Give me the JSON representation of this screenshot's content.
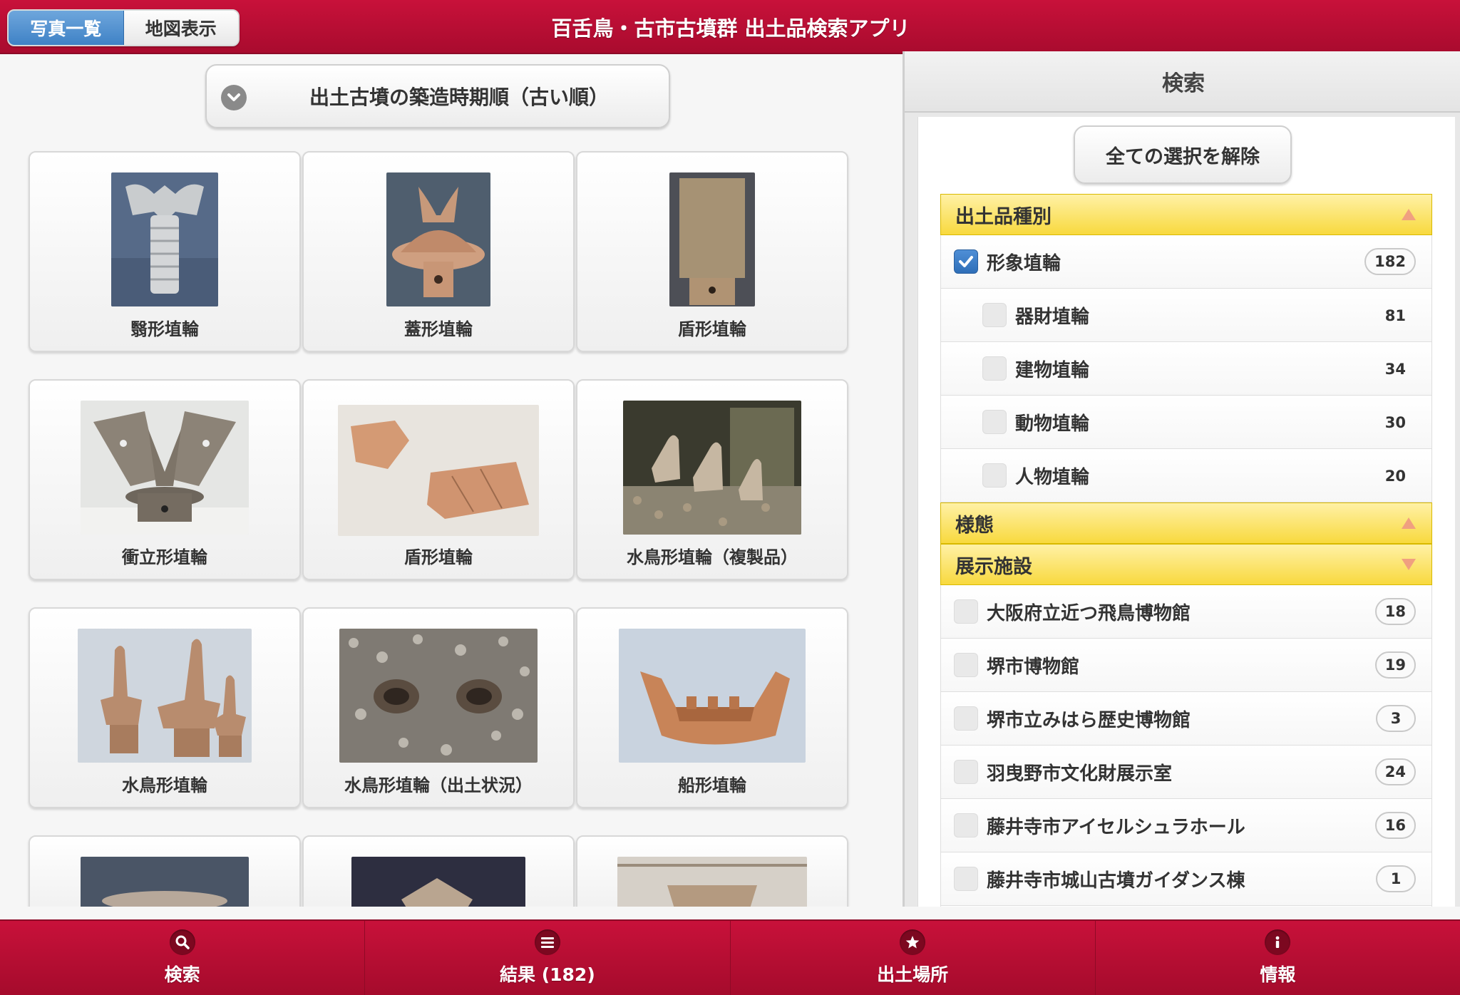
{
  "header": {
    "tabs": [
      {
        "label": "写真一覧",
        "active": true
      },
      {
        "label": "地図表示",
        "active": false
      }
    ],
    "title": "百舌鳥・古市古墳群 出土品検索アプリ"
  },
  "sort": {
    "label": "出土古墳の築造時期順（古い順）",
    "icon": "chevron-down-icon"
  },
  "results": [
    {
      "label": "翳形埴輪",
      "thumb": "ceremonial-fan-haniwa-photo"
    },
    {
      "label": "蓋形埴輪",
      "thumb": "parasol-haniwa-photo"
    },
    {
      "label": "盾形埴輪",
      "thumb": "shield-haniwa-photo"
    },
    {
      "label": "衝立形埴輪",
      "thumb": "screen-haniwa-photo"
    },
    {
      "label": "盾形埴輪",
      "thumb": "shield-fragments-photo"
    },
    {
      "label": "水鳥形埴輪（複製品）",
      "thumb": "waterfowl-replica-photo"
    },
    {
      "label": "水鳥形埴輪",
      "thumb": "waterfowl-haniwa-photo"
    },
    {
      "label": "水鳥形埴輪（出土状況）",
      "thumb": "waterfowl-excavation-photo"
    },
    {
      "label": "船形埴輪",
      "thumb": "boat-haniwa-photo"
    }
  ],
  "search_panel": {
    "title": "検索",
    "clear_label": "全ての選択を解除",
    "groups": [
      {
        "title": "出土品種別",
        "expanded": true,
        "items": [
          {
            "label": "形象埴輪",
            "count": "182",
            "checked": true,
            "level": 0
          },
          {
            "label": "器財埴輪",
            "count": "81",
            "checked": false,
            "level": 1
          },
          {
            "label": "建物埴輪",
            "count": "34",
            "checked": false,
            "level": 1
          },
          {
            "label": "動物埴輪",
            "count": "30",
            "checked": false,
            "level": 1
          },
          {
            "label": "人物埴輪",
            "count": "20",
            "checked": false,
            "level": 1
          }
        ]
      },
      {
        "title": "様態",
        "expanded": true,
        "items": []
      },
      {
        "title": "展示施設",
        "expanded": false,
        "items": [
          {
            "label": "大阪府立近つ飛鳥博物館",
            "count": "18",
            "checked": false
          },
          {
            "label": "堺市博物館",
            "count": "19",
            "checked": false
          },
          {
            "label": "堺市立みはら歴史博物館",
            "count": "3",
            "checked": false
          },
          {
            "label": "羽曳野市文化財展示室",
            "count": "24",
            "checked": false
          },
          {
            "label": "藤井寺市アイセルシュラホール",
            "count": "16",
            "checked": false
          },
          {
            "label": "藤井寺市城山古墳ガイダンス棟",
            "count": "1",
            "checked": false
          }
        ]
      }
    ]
  },
  "tabbar": [
    {
      "label": "検索",
      "icon": "search-icon"
    },
    {
      "label": "結果 (182)",
      "icon": "list-icon"
    },
    {
      "label": "出土場所",
      "icon": "star-icon"
    },
    {
      "label": "情報",
      "icon": "info-icon"
    }
  ],
  "colors": {
    "brand": "#b80f35",
    "accent_blue": "#3f82c6",
    "group_yellow": "#f8d93e"
  }
}
